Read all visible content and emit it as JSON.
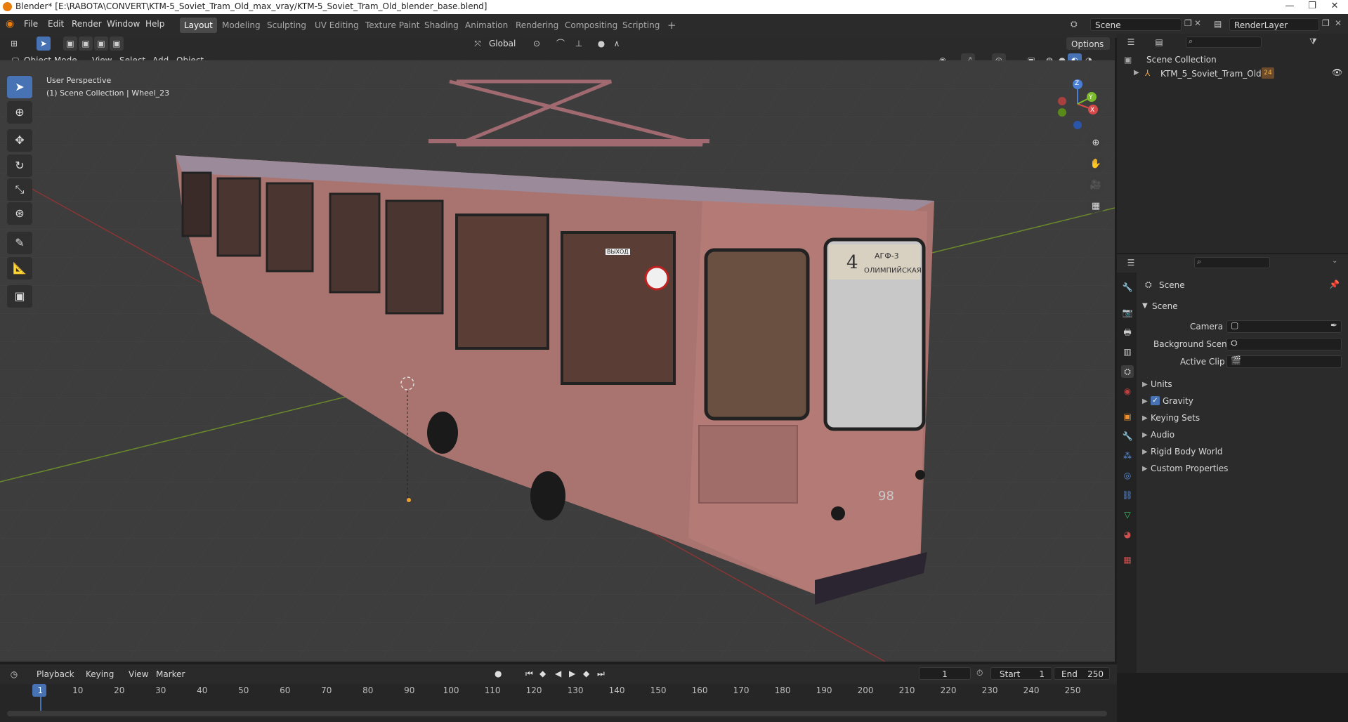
{
  "window": {
    "title": "Blender* [E:\\RABOTA\\CONVERT\\KTM-5_Soviet_Tram_Old_max_vray/KTM-5_Soviet_Tram_Old_blender_base.blend]",
    "controls": [
      "—",
      "❐",
      "✕"
    ]
  },
  "menu": [
    "File",
    "Edit",
    "Render",
    "Window",
    "Help"
  ],
  "workspaces": [
    "Layout",
    "Modeling",
    "Sculpting",
    "UV Editing",
    "Texture Paint",
    "Shading",
    "Animation",
    "Rendering",
    "Compositing",
    "Scripting"
  ],
  "add_workspace": "+",
  "scene_field": "Scene",
  "renderlayer_field": "RenderLayer",
  "viewport_header": {
    "transform_orientation": "Global",
    "options": "Options",
    "mode": "Object Mode",
    "menus": [
      "View",
      "Select",
      "Add",
      "Object"
    ]
  },
  "viewport": {
    "perspective_label": "User Perspective",
    "collection_label": "(1) Scene Collection | Wheel_23",
    "tram_route_number": "4",
    "tram_route_text": "АГФ-3",
    "tram_route_name": "ОЛИМПИЙСКАЯ",
    "tram_side_number": "98",
    "exit_sign": "ВЫХОД",
    "gizmo": {
      "x": "X",
      "y": "Y",
      "z": "Z"
    }
  },
  "outliner": {
    "root": "Scene Collection",
    "items": [
      {
        "label": "KTM_5_Soviet_Tram_Old",
        "badge": "24"
      }
    ]
  },
  "properties": {
    "header": "Scene",
    "section": "Scene",
    "fields": [
      {
        "label": "Camera",
        "value": ""
      },
      {
        "label": "Background Scene",
        "value": ""
      },
      {
        "label": "Active Clip",
        "value": ""
      }
    ],
    "collapsed_sections": [
      "Units",
      "Gravity",
      "Keying Sets",
      "Audio",
      "Rigid Body World",
      "Custom Properties"
    ],
    "gravity_checked": true
  },
  "timeline": {
    "menus": [
      "Playback",
      "Keying",
      "View",
      "Marker"
    ],
    "current_frame": "1",
    "start_label": "Start",
    "start": "1",
    "end_label": "End",
    "end": "250",
    "ticks": [
      "1",
      "10",
      "20",
      "30",
      "40",
      "50",
      "60",
      "70",
      "80",
      "90",
      "100",
      "110",
      "120",
      "130",
      "140",
      "150",
      "160",
      "170",
      "180",
      "190",
      "200",
      "210",
      "220",
      "230",
      "240",
      "250"
    ]
  },
  "colors": {
    "accent": "#4772b3",
    "tram_body": "#b47b76",
    "grid_x": "#9a3a3a",
    "grid_y": "#6a8a2a"
  }
}
